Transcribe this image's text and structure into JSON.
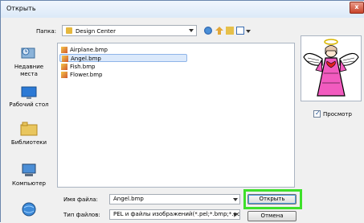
{
  "window": {
    "title": "Открыть",
    "close_label": "x"
  },
  "toolbar": {
    "lookin_label": "Папка:",
    "lookin_value": "Design Center"
  },
  "places": [
    {
      "label": "Недавние\nместа",
      "icon": "recent-places-icon"
    },
    {
      "label": "Рабочий стол",
      "icon": "desktop-icon"
    },
    {
      "label": "Библиотеки",
      "icon": "libraries-icon"
    },
    {
      "label": "Компьютер",
      "icon": "computer-icon"
    },
    {
      "label": "",
      "icon": "network-icon"
    }
  ],
  "files": [
    {
      "name": "Airplane.bmp",
      "selected": false
    },
    {
      "name": "Angel.bmp",
      "selected": true
    },
    {
      "name": "Fish.bmp",
      "selected": false
    },
    {
      "name": "Flower.bmp",
      "selected": false
    }
  ],
  "preview": {
    "label": "Просмотр",
    "checked": true
  },
  "bottom": {
    "filename_label": "Имя файла:",
    "filename_value": "Angel.bmp",
    "filetype_label": "Тип файлов:",
    "filetype_value": "PEL и файлы изображений(*.pel;*.bmp;*.pcd;*.",
    "open_label": "Открыть",
    "cancel_label": "Отмена"
  },
  "colors": {
    "highlight": "#3ee02a",
    "selection": "#dbe9fb"
  }
}
